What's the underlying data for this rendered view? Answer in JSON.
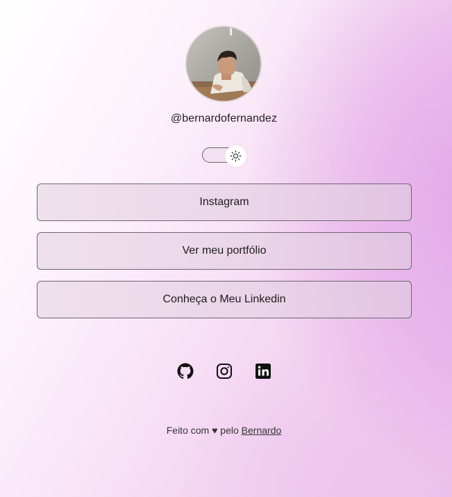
{
  "profile": {
    "username": "@bernardofernandez",
    "avatar_alt": "profile photo"
  },
  "theme_toggle": {
    "state": "light",
    "icon": "sun-icon"
  },
  "links": [
    {
      "label": "Instagram"
    },
    {
      "label": "Ver meu portfólio"
    },
    {
      "label": "Conheça o Meu Linkedin"
    }
  ],
  "social_icons": [
    "github-icon",
    "instagram-icon",
    "linkedin-icon"
  ],
  "footer": {
    "text": "Feito com ♥ pelo",
    "link_text": "Bernardo"
  }
}
